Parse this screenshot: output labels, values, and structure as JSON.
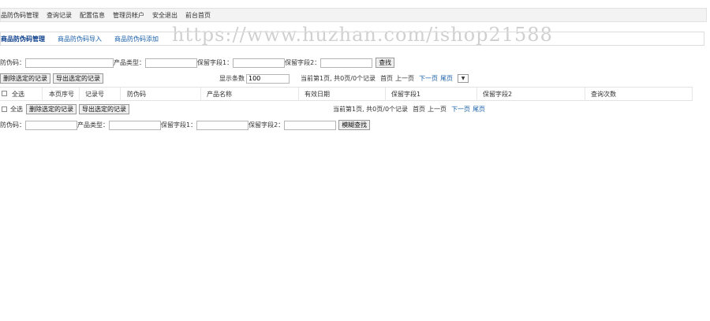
{
  "topnav": [
    "品防伪码管理",
    "查询记录",
    "配置信息",
    "管理员帐户",
    "安全退出",
    "前台首页"
  ],
  "watermark": "https://www.huzhan.com/ishop21588",
  "subnav": [
    "商品防伪码管理",
    "商品防伪码导入",
    "商品防伪码添加"
  ],
  "search_top": {
    "f1": "防伪码：",
    "f2": "产品类型：",
    "f3": "保留字段1：",
    "f4": "保留字段2：",
    "btn": "查找"
  },
  "toolbar": {
    "delete": "删除选定的记录",
    "export": "导出选定的记录",
    "count_label": "显示条数",
    "count_value": "100",
    "pager": "当前第1页, 共0页/0个记录",
    "first": "首页",
    "prev": "上一页",
    "next": "下一页",
    "last": "尾页",
    "select_arrow": "▼"
  },
  "table": {
    "columns": [
      "全选",
      "本页序号",
      "记录号",
      "防伪码",
      "产品名称",
      "有效日期",
      "保留字段1",
      "保留字段2",
      "查询次数"
    ]
  },
  "bottom": {
    "select_all": "全选",
    "delete": "删除选定的记录",
    "export": "导出选定的记录",
    "pager": "当前第1页, 共0页/0个记录",
    "first": "首页",
    "prev": "上一页",
    "next": "下一页",
    "last": "尾页"
  },
  "search_bottom": {
    "f1": "防伪码：",
    "f2": "产品类型：",
    "f3": "保留字段1：",
    "f4": "保留字段2：",
    "btn": "模糊查找"
  }
}
